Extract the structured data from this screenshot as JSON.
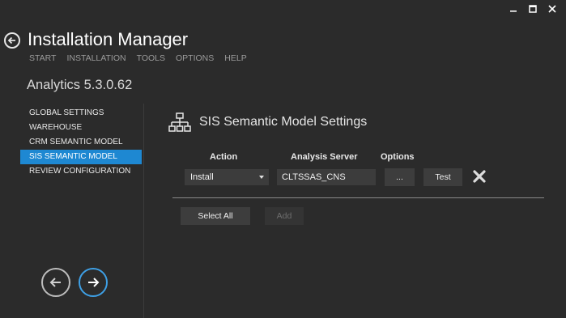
{
  "window": {
    "minimize_icon": "minimize-icon",
    "maximize_icon": "maximize-icon",
    "close_icon": "close-icon"
  },
  "header": {
    "title": "Installation Manager",
    "menu": [
      "START",
      "INSTALLATION",
      "TOOLS",
      "OPTIONS",
      "HELP"
    ]
  },
  "version": "Analytics 5.3.0.62",
  "sidebar": {
    "items": [
      {
        "label": "GLOBAL SETTINGS",
        "active": false
      },
      {
        "label": "WAREHOUSE",
        "active": false
      },
      {
        "label": "CRM SEMANTIC MODEL",
        "active": false
      },
      {
        "label": "SIS SEMANTIC MODEL",
        "active": true
      },
      {
        "label": "REVIEW CONFIGURATION",
        "active": false
      }
    ]
  },
  "section": {
    "title": "SIS Semantic Model Settings",
    "icon": "hierarchy-icon"
  },
  "table": {
    "headers": {
      "action": "Action",
      "server": "Analysis Server",
      "options": "Options"
    },
    "row": {
      "action_value": "Install",
      "server_value": "CLTSSAS_CNS",
      "options_label": "...",
      "test_label": "Test"
    }
  },
  "buttons": {
    "select_all": "Select All",
    "add": "Add"
  },
  "colors": {
    "background": "#2b2b2b",
    "accent": "#1e88d2"
  }
}
